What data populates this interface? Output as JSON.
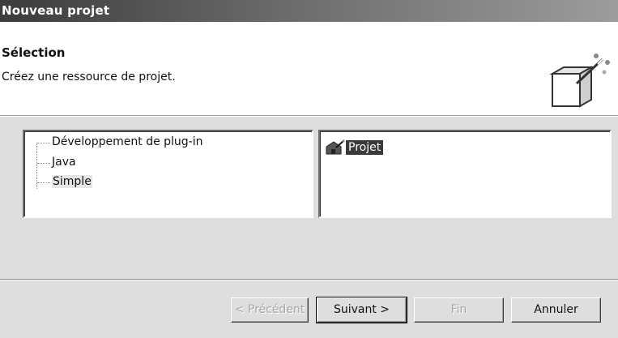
{
  "window": {
    "title": "Nouveau projet"
  },
  "header": {
    "title": "Sélection",
    "description": "Créez une ressource de projet.",
    "icon": "new-project-wizard-icon"
  },
  "wizards_tree": {
    "items": [
      {
        "label": "Développement de plug-in",
        "selected": false
      },
      {
        "label": "Java",
        "selected": false
      },
      {
        "label": "Simple",
        "selected": true
      }
    ]
  },
  "wizards_list": {
    "items": [
      {
        "label": "Projet",
        "icon": "project-folder-icon",
        "selected": true
      }
    ]
  },
  "buttons": {
    "back": {
      "label": "< Précédent",
      "enabled": false
    },
    "next": {
      "label": "Suivant >",
      "enabled": true
    },
    "finish": {
      "label": "Fin",
      "enabled": false
    },
    "cancel": {
      "label": "Annuler",
      "enabled": true
    }
  }
}
